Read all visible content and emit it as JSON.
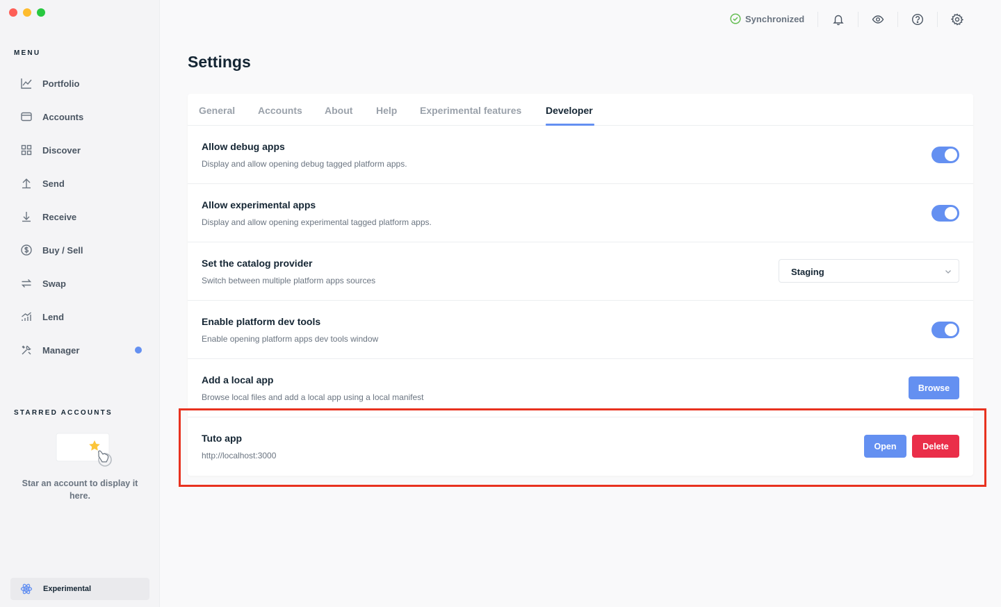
{
  "sidebar": {
    "menu_title": "MENU",
    "items": [
      {
        "label": "Portfolio"
      },
      {
        "label": "Accounts"
      },
      {
        "label": "Discover"
      },
      {
        "label": "Send"
      },
      {
        "label": "Receive"
      },
      {
        "label": "Buy / Sell"
      },
      {
        "label": "Swap"
      },
      {
        "label": "Lend"
      },
      {
        "label": "Manager"
      }
    ],
    "starred_title": "STARRED ACCOUNTS",
    "starred_empty": "Star an account to display it here.",
    "experimental_label": "Experimental"
  },
  "topbar": {
    "sync_label": "Synchronized",
    "icons": [
      "bell-icon",
      "eye-icon",
      "help-icon",
      "gear-icon"
    ]
  },
  "page": {
    "title": "Settings",
    "tabs": [
      {
        "label": "General"
      },
      {
        "label": "Accounts"
      },
      {
        "label": "About"
      },
      {
        "label": "Help"
      },
      {
        "label": "Experimental features"
      },
      {
        "label": "Developer"
      }
    ],
    "active_tab": "Developer",
    "rows": [
      {
        "title": "Allow debug apps",
        "desc": "Display and allow opening debug tagged platform apps.",
        "enabled": true
      },
      {
        "title": "Allow experimental apps",
        "desc": "Display and allow opening experimental tagged platform apps.",
        "enabled": true
      },
      {
        "title": "Set the catalog provider",
        "desc": "Switch between multiple platform apps sources",
        "selected": "Staging"
      },
      {
        "title": "Enable platform dev tools",
        "desc": "Enable opening platform apps dev tools window",
        "enabled": true
      },
      {
        "title": "Add a local app",
        "desc": "Browse local files and add a local app using a local manifest",
        "button": "Browse"
      },
      {
        "title": "Tuto app",
        "desc": "http://localhost:3000",
        "open_button": "Open",
        "delete_button": "Delete"
      }
    ]
  },
  "colors": {
    "accent": "#6490f1",
    "danger": "#ea2e49",
    "sync_ok": "#66be54",
    "highlight": "#e8321f"
  }
}
